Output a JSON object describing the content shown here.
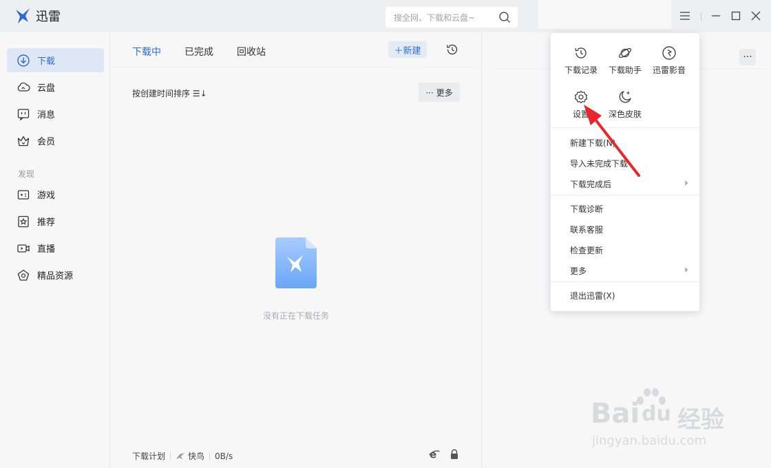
{
  "app": {
    "title": "迅雷"
  },
  "search": {
    "placeholder": "搜全网、下载和云盘~"
  },
  "sidebar": {
    "items": [
      {
        "label": "下载",
        "icon": "download-icon",
        "active": true
      },
      {
        "label": "云盘",
        "icon": "cloud-icon"
      },
      {
        "label": "消息",
        "icon": "message-icon"
      },
      {
        "label": "会员",
        "icon": "crown-icon"
      }
    ],
    "section_label": "发现",
    "discover_items": [
      {
        "label": "游戏",
        "icon": "gamepad-icon"
      },
      {
        "label": "推荐",
        "icon": "star-icon"
      },
      {
        "label": "直播",
        "icon": "live-icon"
      },
      {
        "label": "精品资源",
        "icon": "gem-icon"
      }
    ]
  },
  "main": {
    "tabs": [
      {
        "label": "下载中",
        "active": true
      },
      {
        "label": "已完成"
      },
      {
        "label": "回收站"
      }
    ],
    "new_button": "＋新建",
    "sort_label": "按创建时间排序 ☰↓",
    "more_button": "··· 更多",
    "empty_text": "没有正在下载任务",
    "footer": {
      "plan": "下载计划",
      "bird": "快鸟",
      "speed": "0B/s"
    }
  },
  "menu": {
    "quick": [
      {
        "label": "下载记录",
        "icon": "history-icon"
      },
      {
        "label": "下载助手",
        "icon": "planet-icon"
      },
      {
        "label": "迅雷影音",
        "icon": "play-circle-icon"
      },
      {
        "label": "设置",
        "icon": "gear-icon"
      },
      {
        "label": "深色皮肤",
        "icon": "moon-icon"
      }
    ],
    "group1": [
      "新建下载(N)",
      "导入未完成下载",
      "下载完成后"
    ],
    "group2": [
      "下载诊断",
      "联系客服",
      "检查更新",
      "更多"
    ],
    "group3": [
      "退出迅雷(X)"
    ]
  },
  "watermark": {
    "brand": "Bai",
    "brand2": "du",
    "cn": "经验",
    "url": "jingyan.baidu.com"
  },
  "colors": {
    "accent": "#2d6bd4",
    "active_bg": "#dfe7f6",
    "annotation": "#e8262b"
  }
}
